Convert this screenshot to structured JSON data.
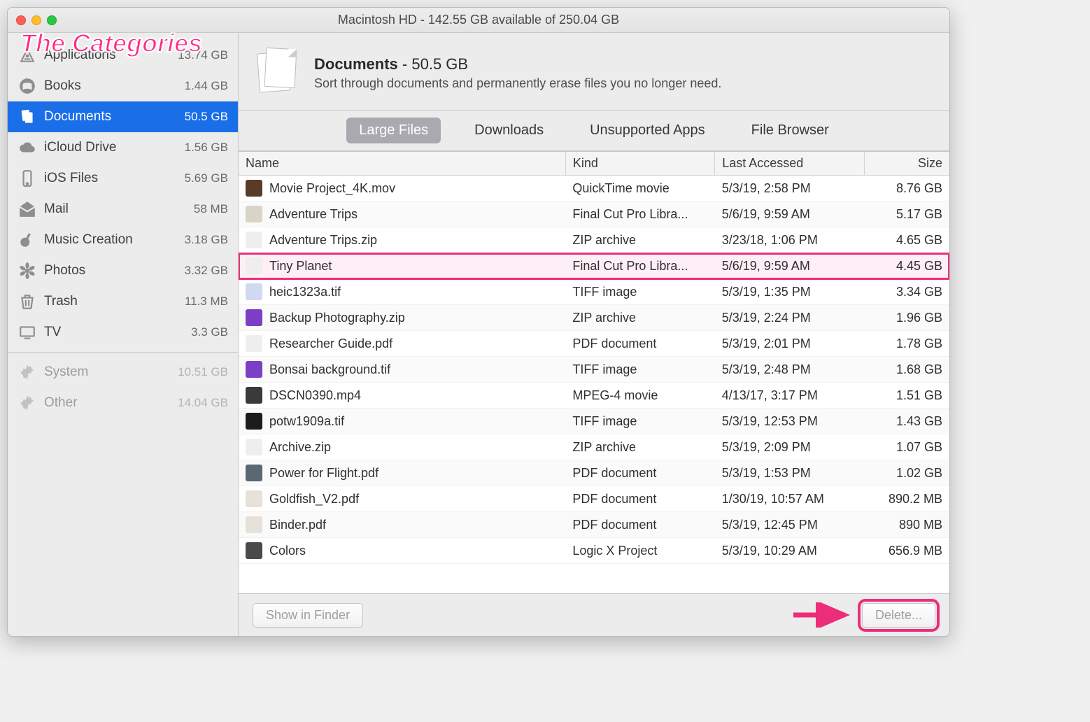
{
  "window": {
    "title": "Macintosh HD - 142.55 GB available of 250.04 GB"
  },
  "annotation": {
    "title": "The Categories",
    "arrow_color": "#ec2e7a"
  },
  "sidebar": {
    "items": [
      {
        "label": "Applications",
        "size": "13.74 GB",
        "icon": "apps",
        "selected": false,
        "disabled": false
      },
      {
        "label": "Books",
        "size": "1.44 GB",
        "icon": "book",
        "selected": false,
        "disabled": false
      },
      {
        "label": "Documents",
        "size": "50.5 GB",
        "icon": "docs",
        "selected": true,
        "disabled": false
      },
      {
        "label": "iCloud Drive",
        "size": "1.56 GB",
        "icon": "cloud",
        "selected": false,
        "disabled": false
      },
      {
        "label": "iOS Files",
        "size": "5.69 GB",
        "icon": "phone",
        "selected": false,
        "disabled": false
      },
      {
        "label": "Mail",
        "size": "58 MB",
        "icon": "mail",
        "selected": false,
        "disabled": false
      },
      {
        "label": "Music Creation",
        "size": "3.18 GB",
        "icon": "guitar",
        "selected": false,
        "disabled": false
      },
      {
        "label": "Photos",
        "size": "3.32 GB",
        "icon": "flower",
        "selected": false,
        "disabled": false
      },
      {
        "label": "Trash",
        "size": "11.3 MB",
        "icon": "trash",
        "selected": false,
        "disabled": false
      },
      {
        "label": "TV",
        "size": "3.3 GB",
        "icon": "tv",
        "selected": false,
        "disabled": false
      }
    ],
    "footer_items": [
      {
        "label": "System",
        "size": "10.51 GB",
        "icon": "gear",
        "disabled": true
      },
      {
        "label": "Other",
        "size": "14.04 GB",
        "icon": "gear",
        "disabled": true
      }
    ]
  },
  "header": {
    "title": "Documents",
    "size": "50.5 GB",
    "subtitle": "Sort through documents and permanently erase files you no longer need."
  },
  "tabs": [
    {
      "label": "Large Files",
      "active": true
    },
    {
      "label": "Downloads",
      "active": false
    },
    {
      "label": "Unsupported Apps",
      "active": false
    },
    {
      "label": "File Browser",
      "active": false
    }
  ],
  "table": {
    "columns": [
      "Name",
      "Kind",
      "Last Accessed",
      "Size"
    ],
    "rows": [
      {
        "name": "Movie Project_4K.mov",
        "kind": "QuickTime movie",
        "date": "5/3/19, 2:58 PM",
        "size": "8.76 GB",
        "icon": "#5a3b2a",
        "hl": false
      },
      {
        "name": "Adventure Trips",
        "kind": "Final Cut Pro Libra...",
        "date": "5/6/19, 9:59 AM",
        "size": "5.17 GB",
        "icon": "#d8d4c8",
        "hl": false
      },
      {
        "name": "Adventure Trips.zip",
        "kind": "ZIP archive",
        "date": "3/23/18, 1:06 PM",
        "size": "4.65 GB",
        "icon": "#eeeeee",
        "hl": false
      },
      {
        "name": "Tiny Planet",
        "kind": "Final Cut Pro Libra...",
        "date": "5/6/19, 9:59 AM",
        "size": "4.45 GB",
        "icon": "#eeeeee",
        "hl": true
      },
      {
        "name": "heic1323a.tif",
        "kind": "TIFF image",
        "date": "5/3/19, 1:35 PM",
        "size": "3.34 GB",
        "icon": "#cfd9ef",
        "hl": false
      },
      {
        "name": "Backup Photography.zip",
        "kind": "ZIP archive",
        "date": "5/3/19, 2:24 PM",
        "size": "1.96 GB",
        "icon": "#7a3fc5",
        "hl": false
      },
      {
        "name": "Researcher Guide.pdf",
        "kind": "PDF document",
        "date": "5/3/19, 2:01 PM",
        "size": "1.78 GB",
        "icon": "#eeeeee",
        "hl": false
      },
      {
        "name": "Bonsai background.tif",
        "kind": "TIFF image",
        "date": "5/3/19, 2:48 PM",
        "size": "1.68 GB",
        "icon": "#7a3fc5",
        "hl": false
      },
      {
        "name": "DSCN0390.mp4",
        "kind": "MPEG-4 movie",
        "date": "4/13/17, 3:17 PM",
        "size": "1.51 GB",
        "icon": "#3a3a3a",
        "hl": false
      },
      {
        "name": "potw1909a.tif",
        "kind": "TIFF image",
        "date": "5/3/19, 12:53 PM",
        "size": "1.43 GB",
        "icon": "#1c1c1c",
        "hl": false
      },
      {
        "name": "Archive.zip",
        "kind": "ZIP archive",
        "date": "5/3/19, 2:09 PM",
        "size": "1.07 GB",
        "icon": "#eeeeee",
        "hl": false
      },
      {
        "name": "Power for Flight.pdf",
        "kind": "PDF document",
        "date": "5/3/19, 1:53 PM",
        "size": "1.02 GB",
        "icon": "#5a6873",
        "hl": false
      },
      {
        "name": "Goldfish_V2.pdf",
        "kind": "PDF document",
        "date": "1/30/19, 10:57 AM",
        "size": "890.2 MB",
        "icon": "#e7e2d9",
        "hl": false
      },
      {
        "name": "Binder.pdf",
        "kind": "PDF document",
        "date": "5/3/19, 12:45 PM",
        "size": "890 MB",
        "icon": "#e7e2d9",
        "hl": false
      },
      {
        "name": "Colors",
        "kind": "Logic X Project",
        "date": "5/3/19, 10:29 AM",
        "size": "656.9 MB",
        "icon": "#4a4a4a",
        "hl": false
      }
    ]
  },
  "buttons": {
    "show": "Show in Finder",
    "delete": "Delete..."
  }
}
